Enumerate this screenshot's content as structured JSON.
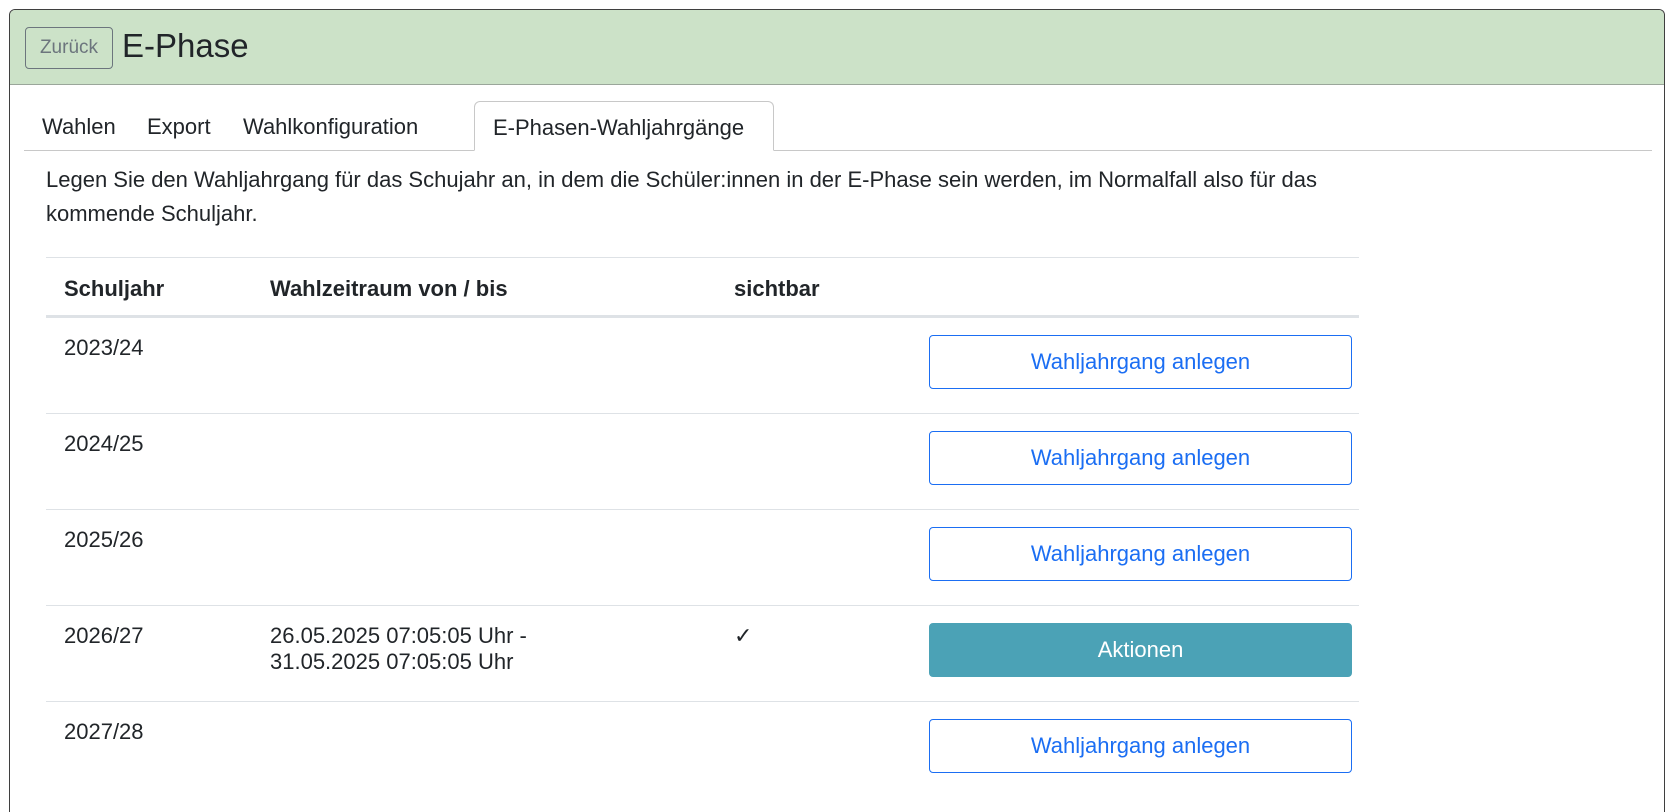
{
  "header": {
    "back_label": "Zurück",
    "title": "E-Phase",
    "background": "#cce2c8"
  },
  "tabs": [
    {
      "label": "Wahlen",
      "active": false
    },
    {
      "label": "Export",
      "active": false
    },
    {
      "label": "Wahlkonfiguration",
      "active": false
    },
    {
      "label": "E-Phasen-Wahljahrgänge",
      "active": true
    }
  ],
  "intro_text": "Legen Sie den Wahljahrgang für das Schujahr an, in dem die Schüler:innen in der E-Phase sein werden, im Normalfall also für das kommende Schuljahr.",
  "table": {
    "headers": {
      "year": "Schuljahr",
      "period": "Wahlzeitraum von / bis",
      "visible": "sichtbar",
      "action": ""
    },
    "rows": [
      {
        "year": "2023/24",
        "period_from": "",
        "period_to": "",
        "visible": "",
        "action": "Wahljahrgang anlegen",
        "action_style": "outline"
      },
      {
        "year": "2024/25",
        "period_from": "",
        "period_to": "",
        "visible": "",
        "action": "Wahljahrgang anlegen",
        "action_style": "outline"
      },
      {
        "year": "2025/26",
        "period_from": "",
        "period_to": "",
        "visible": "",
        "action": "Wahljahrgang anlegen",
        "action_style": "outline"
      },
      {
        "year": "2026/27",
        "period_from": "26.05.2025 07:05:05 Uhr -",
        "period_to": "31.05.2025 07:05:05 Uhr",
        "visible": "✓",
        "action": "Aktionen",
        "action_style": "info"
      },
      {
        "year": "2027/28",
        "period_from": "",
        "period_to": "",
        "visible": "",
        "action": "Wahljahrgang anlegen",
        "action_style": "outline"
      }
    ]
  },
  "colors": {
    "primary": "#1b6ef3",
    "info": "#4ba2b6",
    "secondary": "#6c757d"
  },
  "icons": {
    "visible_check": "check-icon"
  }
}
